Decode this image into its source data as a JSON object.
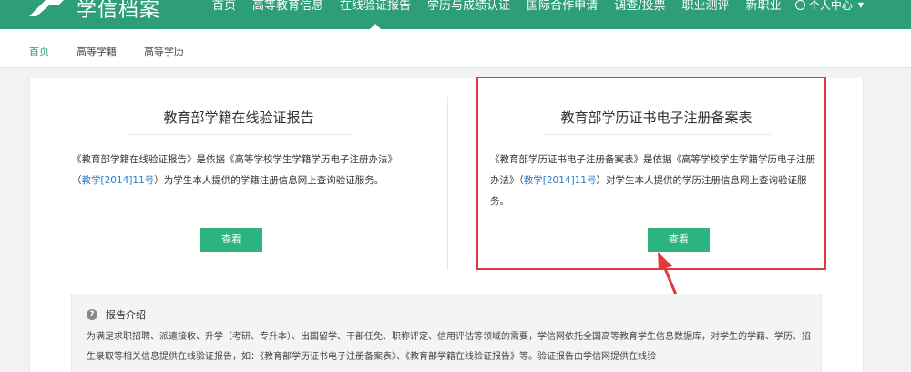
{
  "header": {
    "logo_text": "学信档案",
    "nav": [
      "首页",
      "高等教育信息",
      "在线验证报告",
      "学历与成绩认证",
      "国际合作申请",
      "调查/投票",
      "职业测评",
      "新职业"
    ],
    "active_nav": "在线验证报告",
    "user_menu_label": "个人中心",
    "brand_color": "#2d9d7a"
  },
  "subnav": {
    "items": [
      "首页",
      "高等学籍",
      "高等学历"
    ],
    "active": "首页"
  },
  "cards": [
    {
      "title": "教育部学籍在线验证报告",
      "desc_before": "《教育部学籍在线验证报告》是依据《高等学校学生学籍学历电子注册办法》（",
      "link": "教学[2014]11号",
      "desc_after": "）为学生本人提供的学籍注册信息网上查询验证服务。",
      "button": "查看"
    },
    {
      "title": "教育部学历证书电子注册备案表",
      "desc_before": "《教育部学历证书电子注册备案表》是依据《高等学校学生学籍学历电子注册办法》（",
      "link": "教学[2014]11号",
      "desc_after": "）对学生本人提供的学历注册信息网上查询验证服务。",
      "button": "查看"
    }
  ],
  "intro": {
    "title": "报告介绍",
    "text": "为满足求职招聘、派遣接收、升学（考研、专升本）、出国留学、干部任免、职称评定、信用评估等领域的需要，学信网依托全国高等教育学生信息数据库，对学生的学籍、学历、招生录取等相关信息提供在线验证报告，如：《教育部学历证书电子注册备案表》、《教育部学籍在线验证报告》等。验证报告由学信网提供在线验"
  },
  "annotation_color": "#e0393b"
}
